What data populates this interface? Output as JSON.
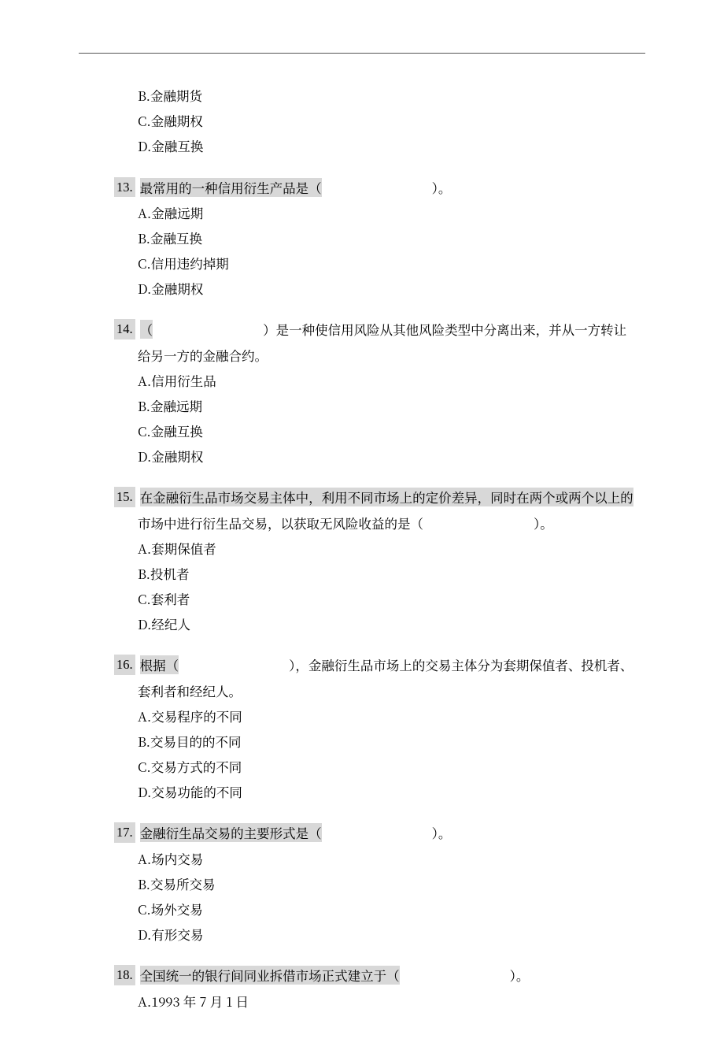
{
  "orphan": {
    "B": "B.金融期货",
    "C": "C.金融期权",
    "D": "D.金融互换"
  },
  "q13": {
    "num": "13.",
    "stem_pre": "最常用的一种信用衍生产品是（",
    "stem_post": "）。",
    "A": "A.金融远期",
    "B": "B.金融互换",
    "C": "C.信用违约掉期",
    "D": "D.金融期权"
  },
  "q14": {
    "num": "14.",
    "stem_pre": "（",
    "stem_post": "）是一种使信用风险从其他风险类型中分离出来，并从一方转让",
    "stem_cont": "给另一方的金融合约。",
    "A": "A.信用衍生品",
    "B": "B.金融远期",
    "C": "C.金融互换",
    "D": "D.金融期权"
  },
  "q15": {
    "num": "15.",
    "stem_line1": "在金融衍生品市场交易主体中，利用不同市场上的定价差异，同时在两个或两个以上的",
    "stem_cont_pre": "市场中进行衍生品交易，以获取无风险收益的是（",
    "stem_cont_post": "）。",
    "A": "A.套期保值者",
    "B": "B.投机者",
    "C": "C.套利者",
    "D": "D.经纪人"
  },
  "q16": {
    "num": "16.",
    "stem_pre": "根据（",
    "stem_post": "），金融衍生品市场上的交易主体分为套期保值者、投机者、",
    "stem_cont": "套利者和经纪人。",
    "A": "A.交易程序的不同",
    "B": "B.交易目的的不同",
    "C": "C.交易方式的不同",
    "D": "D.交易功能的不同"
  },
  "q17": {
    "num": "17.",
    "stem_pre": "金融衍生品交易的主要形式是（",
    "stem_post": "）。",
    "A": "A.场内交易",
    "B": "B.交易所交易",
    "C": "C.场外交易",
    "D": "D.有形交易"
  },
  "q18": {
    "num": "18.",
    "stem_pre": "全国统一的银行间同业拆借市场正式建立于（",
    "stem_post": "）。",
    "A": "A.1993 年 7 月 1 日"
  }
}
